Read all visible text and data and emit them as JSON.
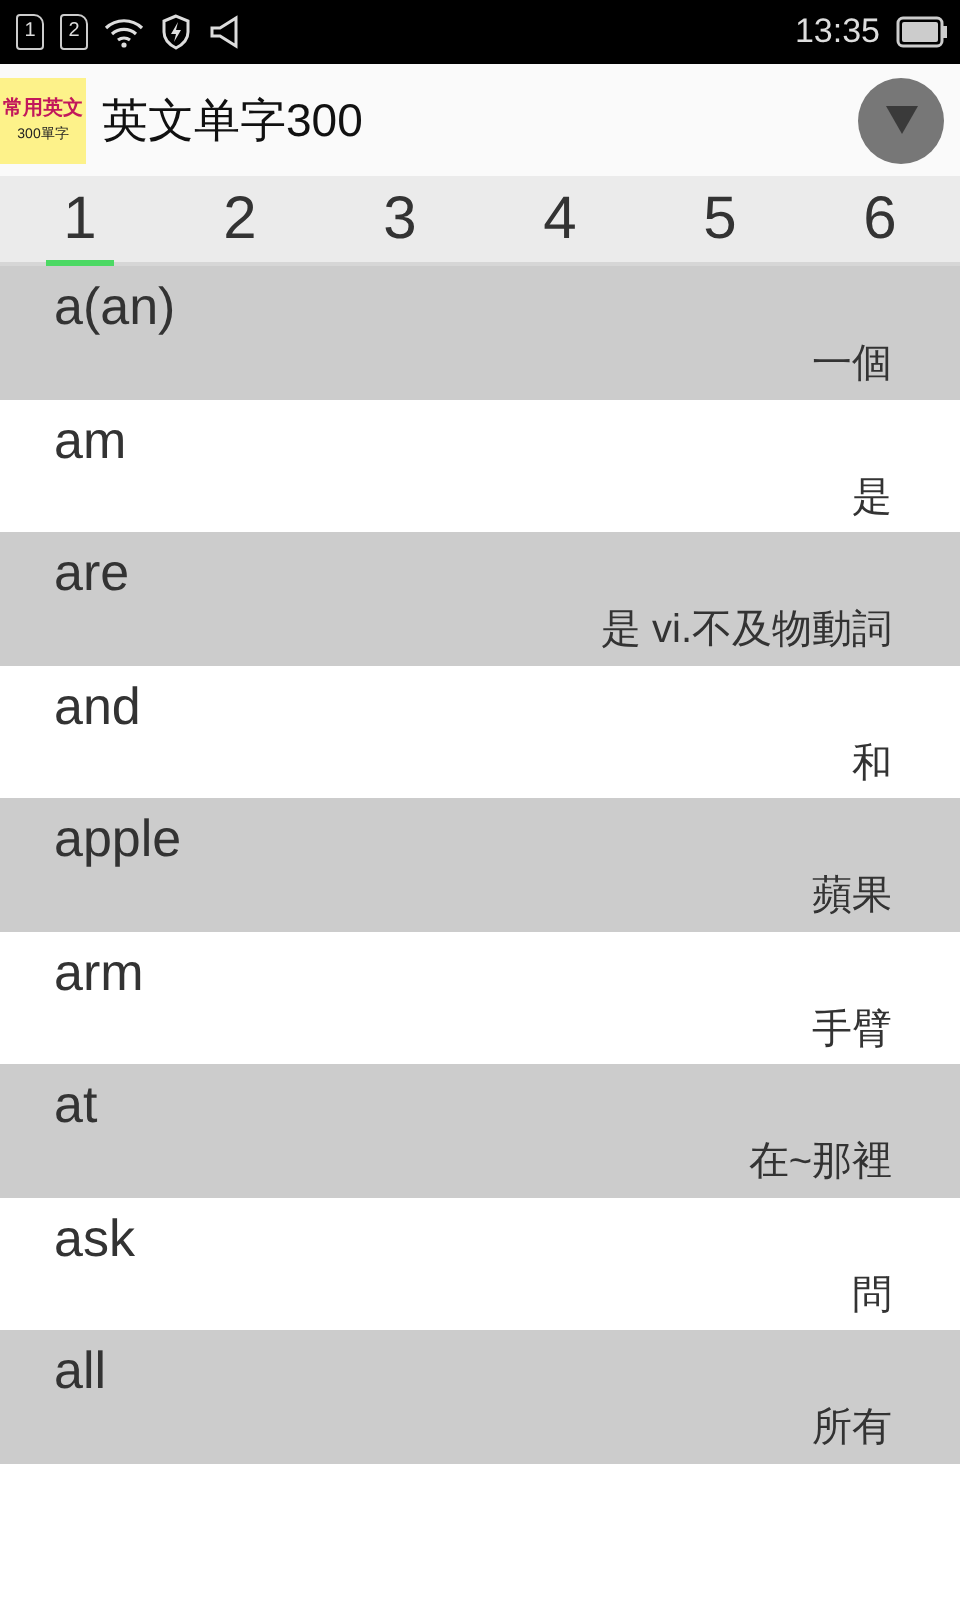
{
  "status_bar": {
    "sim_slots": [
      "1",
      "2"
    ],
    "time": "13:35"
  },
  "app_bar": {
    "logo_texts": [
      "常用英文",
      "300單字"
    ],
    "title": "英文单字300"
  },
  "tabs": [
    {
      "label": "1",
      "selected": true
    },
    {
      "label": "2",
      "selected": false
    },
    {
      "label": "3",
      "selected": false
    },
    {
      "label": "4",
      "selected": false
    },
    {
      "label": "5",
      "selected": false
    },
    {
      "label": "6",
      "selected": false
    }
  ],
  "words": [
    {
      "word": "a(an)",
      "meaning": "一個"
    },
    {
      "word": "am",
      "meaning": "是"
    },
    {
      "word": "are",
      "meaning": "是 vi.不及物動詞"
    },
    {
      "word": "and",
      "meaning": "和"
    },
    {
      "word": "apple",
      "meaning": "蘋果"
    },
    {
      "word": "arm",
      "meaning": "手臂"
    },
    {
      "word": "at",
      "meaning": "在~那裡"
    },
    {
      "word": "ask",
      "meaning": "問"
    },
    {
      "word": "all",
      "meaning": "所有"
    }
  ]
}
